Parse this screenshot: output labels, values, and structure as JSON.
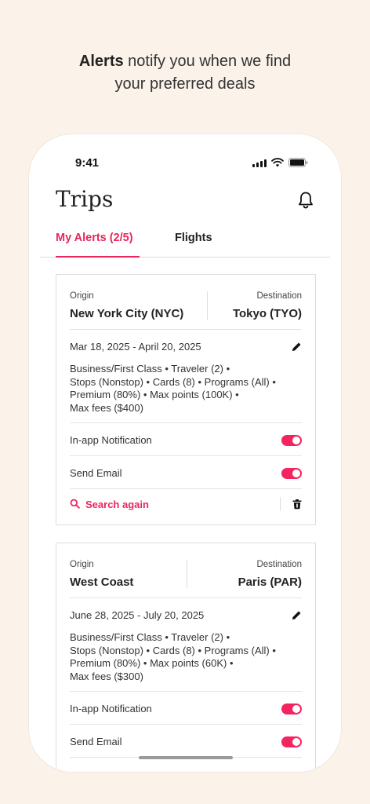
{
  "headline": {
    "bold": "Alerts",
    "rest_line1": " notify you when we find",
    "line2": "your preferred deals"
  },
  "status": {
    "time": "9:41"
  },
  "page": {
    "title": "Trips"
  },
  "tabs": [
    {
      "label": "My Alerts (2/5)"
    },
    {
      "label": "Flights"
    }
  ],
  "colors": {
    "accent": "#e8265e",
    "toggle_on": "#f2255e",
    "background": "#fbf3ea"
  },
  "alerts": [
    {
      "origin_label": "Origin",
      "origin": "New York City (NYC)",
      "destination_label": "Destination",
      "destination": "Tokyo (TYO)",
      "dates": "Mar 18, 2025 - April 20, 2025",
      "details": [
        "Business/First Class  •  Traveler (2)   •",
        "Stops (Nonstop) • Cards (8)  •  Programs (All) •",
        "Premium (80%) • Max points (100K) •",
        "Max fees ($400)"
      ],
      "notification_label": "In-app Notification",
      "notification_on": true,
      "email_label": "Send Email",
      "email_on": true,
      "search_again_label": "Search again"
    },
    {
      "origin_label": "Origin",
      "origin": "West Coast",
      "destination_label": "Destination",
      "destination": "Paris (PAR)",
      "dates": "June 28, 2025 - July 20, 2025",
      "details": [
        "Business/First Class  •  Traveler (2)   •",
        "Stops (Nonstop) • Cards (8)  •  Programs (All) •",
        "Premium (80%) • Max points (60K) •",
        "Max fees ($300)"
      ],
      "notification_label": "In-app Notification",
      "notification_on": true,
      "email_label": "Send Email",
      "email_on": true
    }
  ]
}
